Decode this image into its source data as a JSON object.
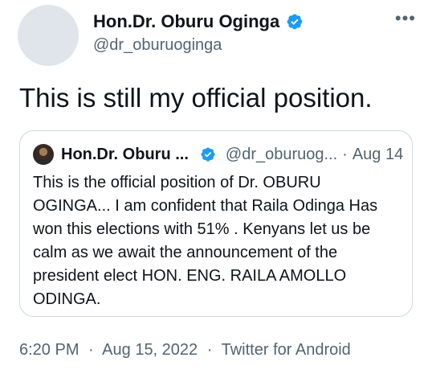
{
  "author": {
    "name": "Hon.Dr. Oburu Oginga",
    "handle": "@dr_oburuoginga"
  },
  "more_glyph": "•••",
  "tweet_text": "This is still my official position.",
  "quoted": {
    "name": "Hon.Dr. Oburu ...",
    "handle": "@dr_oburuog...",
    "separator": "·",
    "date": "Aug 14",
    "text": "This is the official position of Dr. OBURU OGINGA... I am confident that Raila Odinga Has won this elections with 51% . Kenyans let us be calm as we await the announcement of the president elect HON. ENG. RAILA AMOLLO ODINGA."
  },
  "meta": {
    "time": "6:20 PM",
    "date": "Aug 15, 2022",
    "source": "Twitter for Android",
    "separator": "·"
  },
  "colors": {
    "verified_blue": "#1d9bf0",
    "secondary_text": "#536471",
    "border": "#cfd9de"
  },
  "icons": {
    "verified": "verified-badge-icon",
    "more": "more-options-icon"
  }
}
